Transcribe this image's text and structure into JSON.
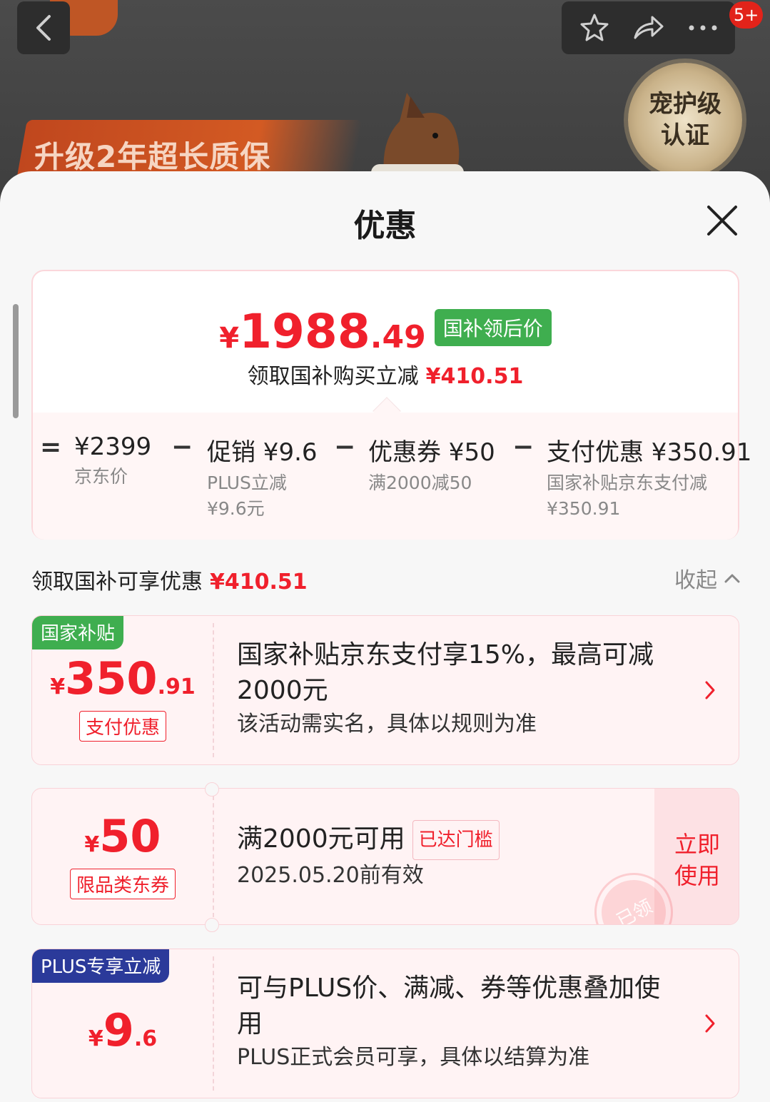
{
  "header": {
    "badge_count": "5+",
    "banner_text": "升级2年超长质保",
    "seal_line1": "宠护级",
    "seal_line2": "认证"
  },
  "sheet": {
    "title": "优惠"
  },
  "summary": {
    "price_symbol": "¥",
    "price_int": "1988",
    "price_dec": ".49",
    "price_tag": "国补领后价",
    "save_label": "领取国补购买立减",
    "save_amount": "¥410.51",
    "calc": {
      "equals": "=",
      "minus": "−",
      "items": [
        {
          "value": "¥2399",
          "sub1": "京东价",
          "sub2": ""
        },
        {
          "value": "促销 ¥9.6",
          "sub1": "PLUS立减",
          "sub2": "¥9.6元"
        },
        {
          "value": "优惠券 ¥50",
          "sub1": "满2000减50",
          "sub2": ""
        },
        {
          "value": "支付优惠 ¥350.91",
          "sub1": "国家补贴京东支付减",
          "sub2": "¥350.91"
        }
      ]
    }
  },
  "section": {
    "title": "领取国补可享优惠",
    "amount": "¥410.51",
    "collapse_label": "收起"
  },
  "cards": [
    {
      "corner_tag": "国家补贴",
      "corner_color": "#3fae4f",
      "symbol": "¥",
      "int": "350",
      "dec": ".91",
      "type_tag": "支付优惠",
      "desc_line1": "国家补贴京东支付享15%，最高可减",
      "desc_line2": "2000元",
      "note": "该活动需实名，具体以规则为准"
    },
    {
      "symbol": "¥",
      "int": "50",
      "dec": "",
      "type_tag": "限品类东券",
      "desc": "满2000元可用",
      "reached": "已达门槛",
      "note": "2025.05.20前有效",
      "use_now_1": "立即",
      "use_now_2": "使用",
      "stamp": "已领"
    },
    {
      "corner_tag": "PLUS专享立减",
      "corner_color": "#2b3a9a",
      "symbol": "¥",
      "int": "9",
      "dec": ".6",
      "desc_line1": "可与PLUS价、满减、券等优惠叠加使",
      "desc_line2": "用",
      "note": "PLUS正式会员可享，具体以结算为准"
    }
  ]
}
